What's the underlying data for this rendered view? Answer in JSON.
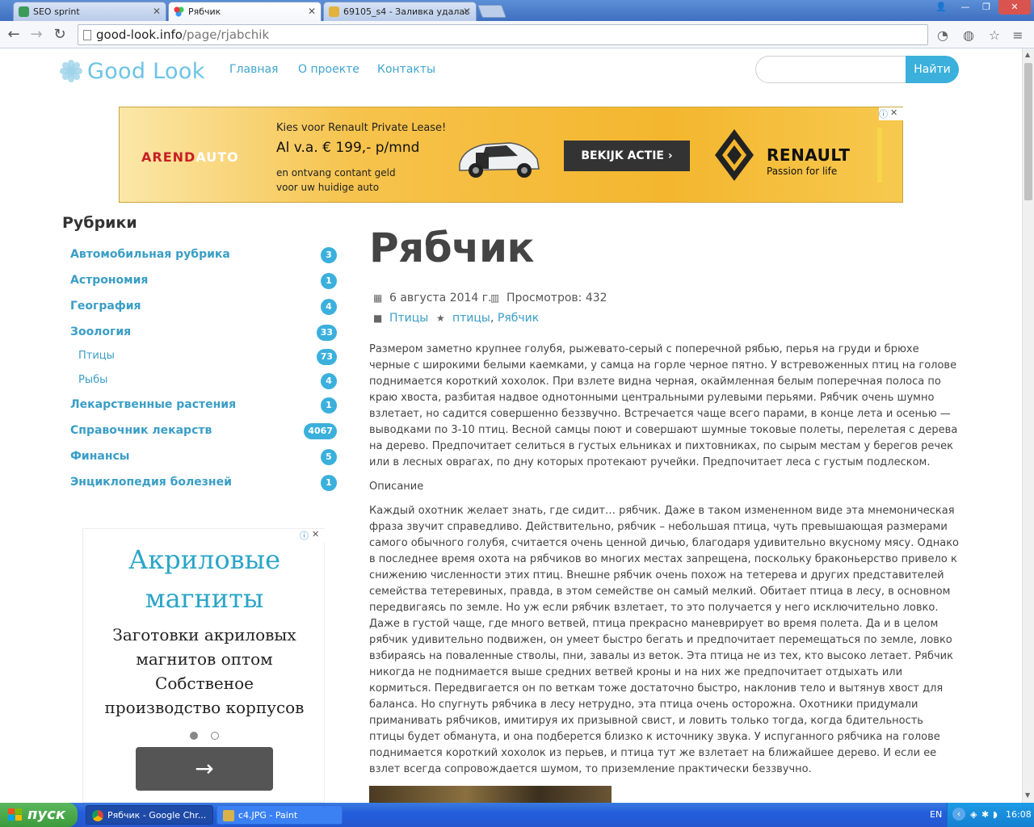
{
  "browser": {
    "tabs": [
      {
        "title": "SEO sprint",
        "favicon_color": "#3c9a5a"
      },
      {
        "title": "Рябчик",
        "favicon_color": "#5a8fd0"
      },
      {
        "title": "69105_s4 - Заливка удалас",
        "favicon_color": "#e2b23a"
      }
    ],
    "close_glyph": "✕",
    "url_domain": "good-look.info",
    "url_path": "/page/rjabchik",
    "window_buttons": [
      "👤",
      "—",
      "❐",
      "✕"
    ]
  },
  "site": {
    "logo_text": "Good Look",
    "nav": [
      "Главная",
      "О проекте",
      "Контакты"
    ],
    "search_placeholder": "",
    "search_button": "Найти"
  },
  "banner_ad": {
    "brand_left": "AREND",
    "brand_right": "AUTO",
    "line1": "Kies voor Renault Private Lease!",
    "line2": "Al v.a. € 199,- p/mnd",
    "line3": "en ontvang contant geld voor uw huidige auto",
    "cta": "BEKIJK ACTIE  ›",
    "brand2": "RENAULT",
    "tagline": "Passion for life",
    "info_glyph": "ⓘ",
    "close_glyph": "✕"
  },
  "sidebar": {
    "title": "Рубрики",
    "categories": [
      {
        "label": "Автомобильная рубрика",
        "count": "3"
      },
      {
        "label": "Астрономия",
        "count": "1"
      },
      {
        "label": "География",
        "count": "4"
      },
      {
        "label": "Зоология",
        "count": "33"
      },
      {
        "label": "Птицы",
        "count": "73"
      },
      {
        "label": "Рыбы",
        "count": "4"
      },
      {
        "label": "Лекарственные растения",
        "count": "1"
      },
      {
        "label": "Справочник лекарств",
        "count": "4067"
      },
      {
        "label": "Финансы",
        "count": "5"
      },
      {
        "label": "Энциклопедия болезней",
        "count": "1"
      }
    ]
  },
  "side_ad": {
    "headline_1": "Акриловые",
    "headline_2": "магниты",
    "desc_1": "Заготовки акриловых",
    "desc_2": "магнитов оптом",
    "desc_3": "Собственое",
    "desc_4": "производство корпусов",
    "arrow": "→",
    "info_glyph": "ⓘ",
    "close_glyph": "✕"
  },
  "article": {
    "title": "Рябчик",
    "date": "6 августа 2014 г.",
    "views": "Просмотров: 432",
    "category": "Птицы",
    "tag1": "птицы",
    "tag_sep": ", ",
    "tag2": "Рябчик",
    "p1": "Размером заметно крупнее голубя, рыжевато-серый с поперечной рябью, перья на груди и брюхе черные с широкими белыми каемками, у самца на горле черное пятно. У встревоженных птиц на голове поднимается короткий хохолок. При взлете видна черная, окаймленная белым поперечная полоса по краю хвоста, разбитая надвое однотонными центральными рулевыми перьями. Рябчик очень шумно взлетает, но садится совершенно беззвучно. Встречается чаще всего парами, в конце лета и осенью — выводками по 3-10 птиц. Весной самцы поют и совершают шумные токовые полеты, перелетая с дерева на дерево. Предпочитает селиться в густых ельниках и пихтовниках, по сырым местам у берегов речек или в лесных оврагах, по дну которых протекают ручейки. Предпочитает леса с густым подлеском.",
    "subheading": "Описание",
    "p2": "Каждый охотник желает знать, где сидит… рябчик. Даже в таком измененном виде эта мнемоническая фраза звучит справедливо. Действительно, рябчик – небольшая птица, чуть превышающая размерами самого обычного голубя, считается очень ценной дичью, благодаря удивительно вкусному мясу. Однако в последнее время охота на рябчиков во многих местах запрещена, поскольку браконьерство привело к снижению численности этих птиц. Внешне рябчик очень похож на тетерева и других представителей семейства тетеревиных, правда, в этом семействе он самый мелкий. Обитает птица в лесу, в основном передвигаясь по земле. Но уж если рябчик взлетает, то это получается у него исключительно ловко. Даже в густой чаще, где много ветвей, птица прекрасно маневрирует во время полета. Да и в целом рябчик удивительно подвижен, он умеет быстро бегать и предпочитает перемещаться по земле, ловко взбираясь на поваленные стволы, пни, завалы из веток. Эта птица не из тех, кто высоко летает. Рябчик никогда не поднимается выше средних ветвей кроны и на них же предпочитает отдыхать или кормиться. Передвигается он по веткам тоже достаточно быстро, наклонив тело и вытянув хвост для баланса. Но спугнуть рябчика в лесу нетрудно, эта птица очень осторожна. Охотники придумали приманивать рябчиков, имитируя их призывной свист, и ловить только тогда, когда бдительность птицы будет обманута, и она подберется близко к источнику звука. У испуганного рябчика на голове поднимается короткий хохолок из перьев, и птица тут же взлетает на ближайшее дерево. И если ее взлет всегда сопровождается шумом, то приземление практически беззвучно."
  },
  "taskbar": {
    "start_label": "пуск",
    "tasks": [
      {
        "label": "Рябчик - Google Chr...",
        "icon_color": "#e05a3a"
      },
      {
        "label": "c4.JPG - Paint",
        "icon_color": "#d9b34a"
      }
    ],
    "lang": "EN",
    "time": "16:08"
  },
  "colors": {
    "accent": "#3bb0dc",
    "link": "#3a9ec6",
    "heading": "#444444"
  }
}
